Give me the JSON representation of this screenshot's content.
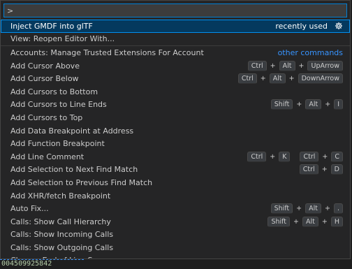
{
  "search": {
    "value": ">"
  },
  "selected_row": {
    "label": "Inject GMDF into glTF",
    "badge": "recently used",
    "icon": "gear-icon"
  },
  "rows": [
    {
      "label": "View: Reopen Editor With...",
      "keys": []
    },
    {
      "label": "Accounts: Manage Trusted Extensions For Account",
      "link": "other commands",
      "keys": []
    },
    {
      "label": "Add Cursor Above",
      "keys": [
        [
          "Ctrl",
          "Alt",
          "UpArrow"
        ]
      ]
    },
    {
      "label": "Add Cursor Below",
      "keys": [
        [
          "Ctrl",
          "Alt",
          "DownArrow"
        ]
      ]
    },
    {
      "label": "Add Cursors to Bottom",
      "keys": []
    },
    {
      "label": "Add Cursors to Line Ends",
      "keys": [
        [
          "Shift",
          "Alt",
          "I"
        ]
      ]
    },
    {
      "label": "Add Cursors to Top",
      "keys": []
    },
    {
      "label": "Add Data Breakpoint at Address",
      "keys": []
    },
    {
      "label": "Add Function Breakpoint",
      "keys": []
    },
    {
      "label": "Add Line Comment",
      "keys": [
        [
          "Ctrl",
          "K"
        ],
        [
          "Ctrl",
          "C"
        ]
      ]
    },
    {
      "label": "Add Selection to Next Find Match",
      "keys": [
        [
          "Ctrl",
          "D"
        ]
      ]
    },
    {
      "label": "Add Selection to Previous Find Match",
      "keys": []
    },
    {
      "label": "Add XHR/fetch Breakpoint",
      "keys": []
    },
    {
      "label": "Auto Fix...",
      "keys": [
        [
          "Shift",
          "Alt",
          "."
        ]
      ]
    },
    {
      "label": "Calls: Show Call Hierarchy",
      "keys": [
        [
          "Shift",
          "Alt",
          "H"
        ]
      ]
    },
    {
      "label": "Calls: Show Incoming Calls",
      "keys": []
    },
    {
      "label": "Calls: Show Outgoing Calls",
      "keys": []
    },
    {
      "label": "Change End of Line Sequence",
      "keys": []
    }
  ],
  "bottom_text": "004509925842",
  "colors": {
    "accent": "#007fd4",
    "selection": "#04395e",
    "link": "#3794ff"
  }
}
